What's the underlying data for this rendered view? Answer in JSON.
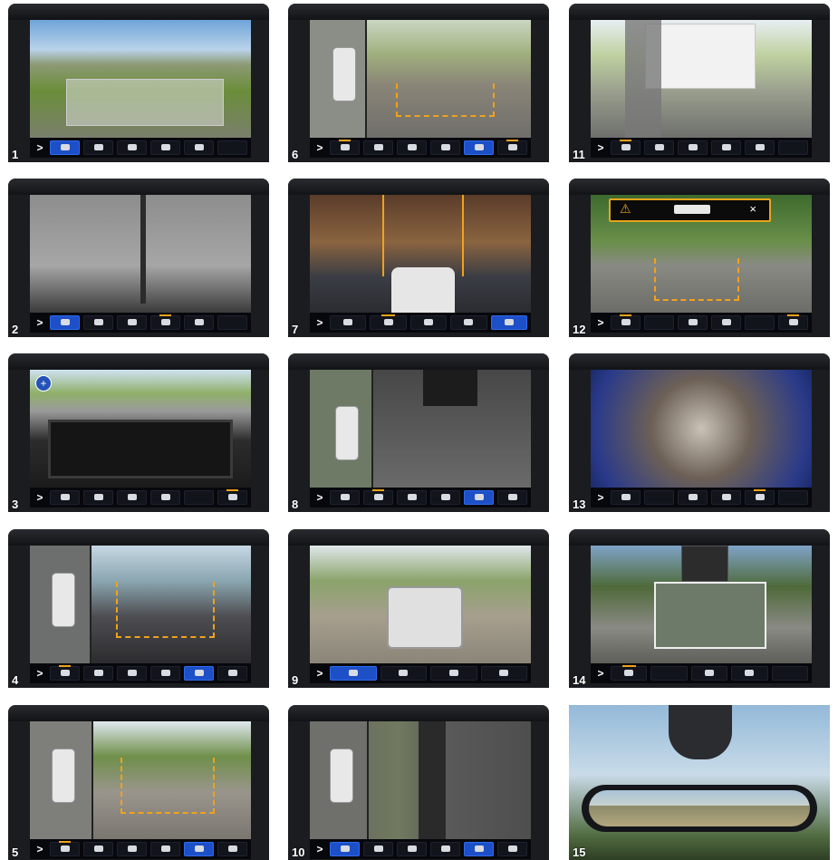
{
  "tiles": [
    {
      "number": "1"
    },
    {
      "number": "6"
    },
    {
      "number": "11"
    },
    {
      "number": "2"
    },
    {
      "number": "7"
    },
    {
      "number": "12"
    },
    {
      "number": "3"
    },
    {
      "number": "8"
    },
    {
      "number": "13"
    },
    {
      "number": "4"
    },
    {
      "number": "9"
    },
    {
      "number": "14"
    },
    {
      "number": "5"
    },
    {
      "number": "10"
    },
    {
      "number": "15"
    }
  ],
  "toolbar": {
    "expand_glyph": ">"
  },
  "alert": {
    "close_glyph": "×"
  },
  "colors": {
    "accent_blue": "#1d4fc7",
    "guide_orange": "#f0a21b",
    "guide_red": "#e0342b",
    "bezel": "#1b1c20"
  }
}
